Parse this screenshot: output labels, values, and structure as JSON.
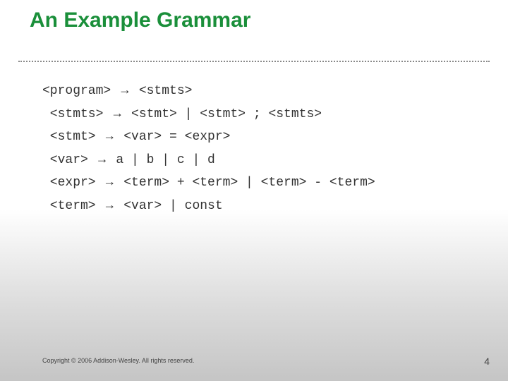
{
  "title": "An Example Grammar",
  "grammar_lines": {
    "l0": "<program> → <stmts>",
    "l1": " <stmts> → <stmt> | <stmt> ; <stmts>",
    "l2": " <stmt> → <var> = <expr>",
    "l3": " <var> → a | b | c | d",
    "l4": " <expr> → <term> + <term> | <term> - <term>",
    "l5": " <term> → <var> | const"
  },
  "copyright": "Copyright © 2006 Addison-Wesley. All rights reserved.",
  "page_number": "4"
}
